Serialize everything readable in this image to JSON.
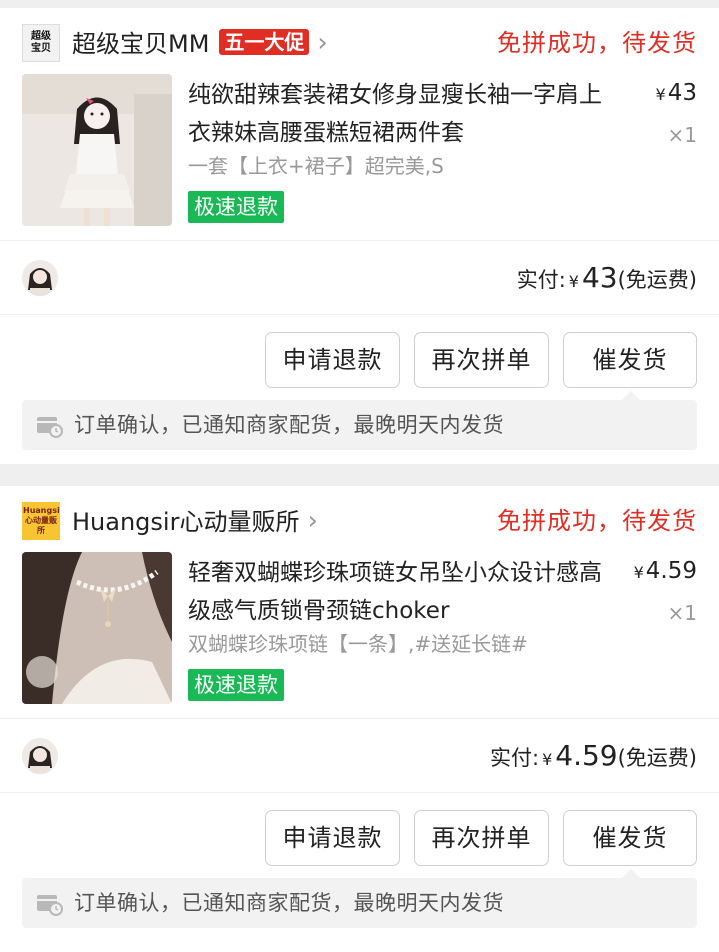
{
  "orders": [
    {
      "store_logo_text": "超级宝贝",
      "store_name": "超级宝贝MM",
      "promo_badge": "五一大促",
      "status": "免拼成功，待发货",
      "title": "纯欲甜辣套装裙女修身显瘦长袖一字肩上衣辣妹高腰蛋糕短裙两件套",
      "spec": "一套【上衣+裙子】超完美,S",
      "price": "43",
      "currency": "¥",
      "quantity": "×1",
      "refund_tag": "极速退款",
      "paid_label": "实付:",
      "paid_amount": "43",
      "shipping_note": "(免运费)",
      "buttons": {
        "refund": "申请退款",
        "reorder": "再次拼单",
        "urge": "催发货"
      },
      "notice": "订单确认，已通知商家配货，最晚明天内发货"
    },
    {
      "store_logo_text": "Huangsir心动量贩所",
      "store_name": "Huangsir心动量贩所",
      "promo_badge": "",
      "status": "免拼成功，待发货",
      "title": "轻奢双蝴蝶珍珠项链女吊坠小众设计感高级感气质锁骨颈链choker",
      "spec": "双蝴蝶珍珠项链【一条】,#送延长链#",
      "price": "4.59",
      "currency": "¥",
      "quantity": "×1",
      "refund_tag": "极速退款",
      "paid_label": "实付:",
      "paid_amount": "4.59",
      "shipping_note": "(免运费)",
      "buttons": {
        "refund": "申请退款",
        "reorder": "再次拼单",
        "urge": "催发货"
      },
      "notice": "订单确认，已通知商家配货，最晚明天内发货"
    }
  ],
  "colors": {
    "status_red": "#e02e24",
    "refund_green": "#19b955",
    "page_bg": "#efefef"
  },
  "icons": [
    "chevron-right-icon",
    "truck-clock-icon"
  ]
}
